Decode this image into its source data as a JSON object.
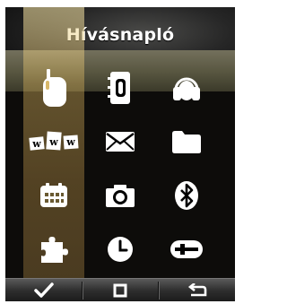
{
  "header": {
    "title": "Hívásnapló"
  },
  "menu": {
    "items": [
      {
        "name": "walkie-talkie-icon",
        "selected": true
      },
      {
        "name": "phonebook-icon"
      },
      {
        "name": "headset-icon"
      },
      {
        "name": "www-icon"
      },
      {
        "name": "envelope-icon"
      },
      {
        "name": "folder-icon"
      },
      {
        "name": "calendar-icon"
      },
      {
        "name": "camera-icon"
      },
      {
        "name": "bluetooth-icon"
      },
      {
        "name": "puzzle-icon"
      },
      {
        "name": "clock-icon"
      },
      {
        "name": "settings-icon"
      }
    ],
    "www_label": "www"
  },
  "softkeys": {
    "left": "check-icon",
    "center": "square-icon",
    "right": "back-icon"
  },
  "colors": {
    "highlight": "#d9c27a",
    "icon": "#ffffff",
    "background": "#000000"
  }
}
